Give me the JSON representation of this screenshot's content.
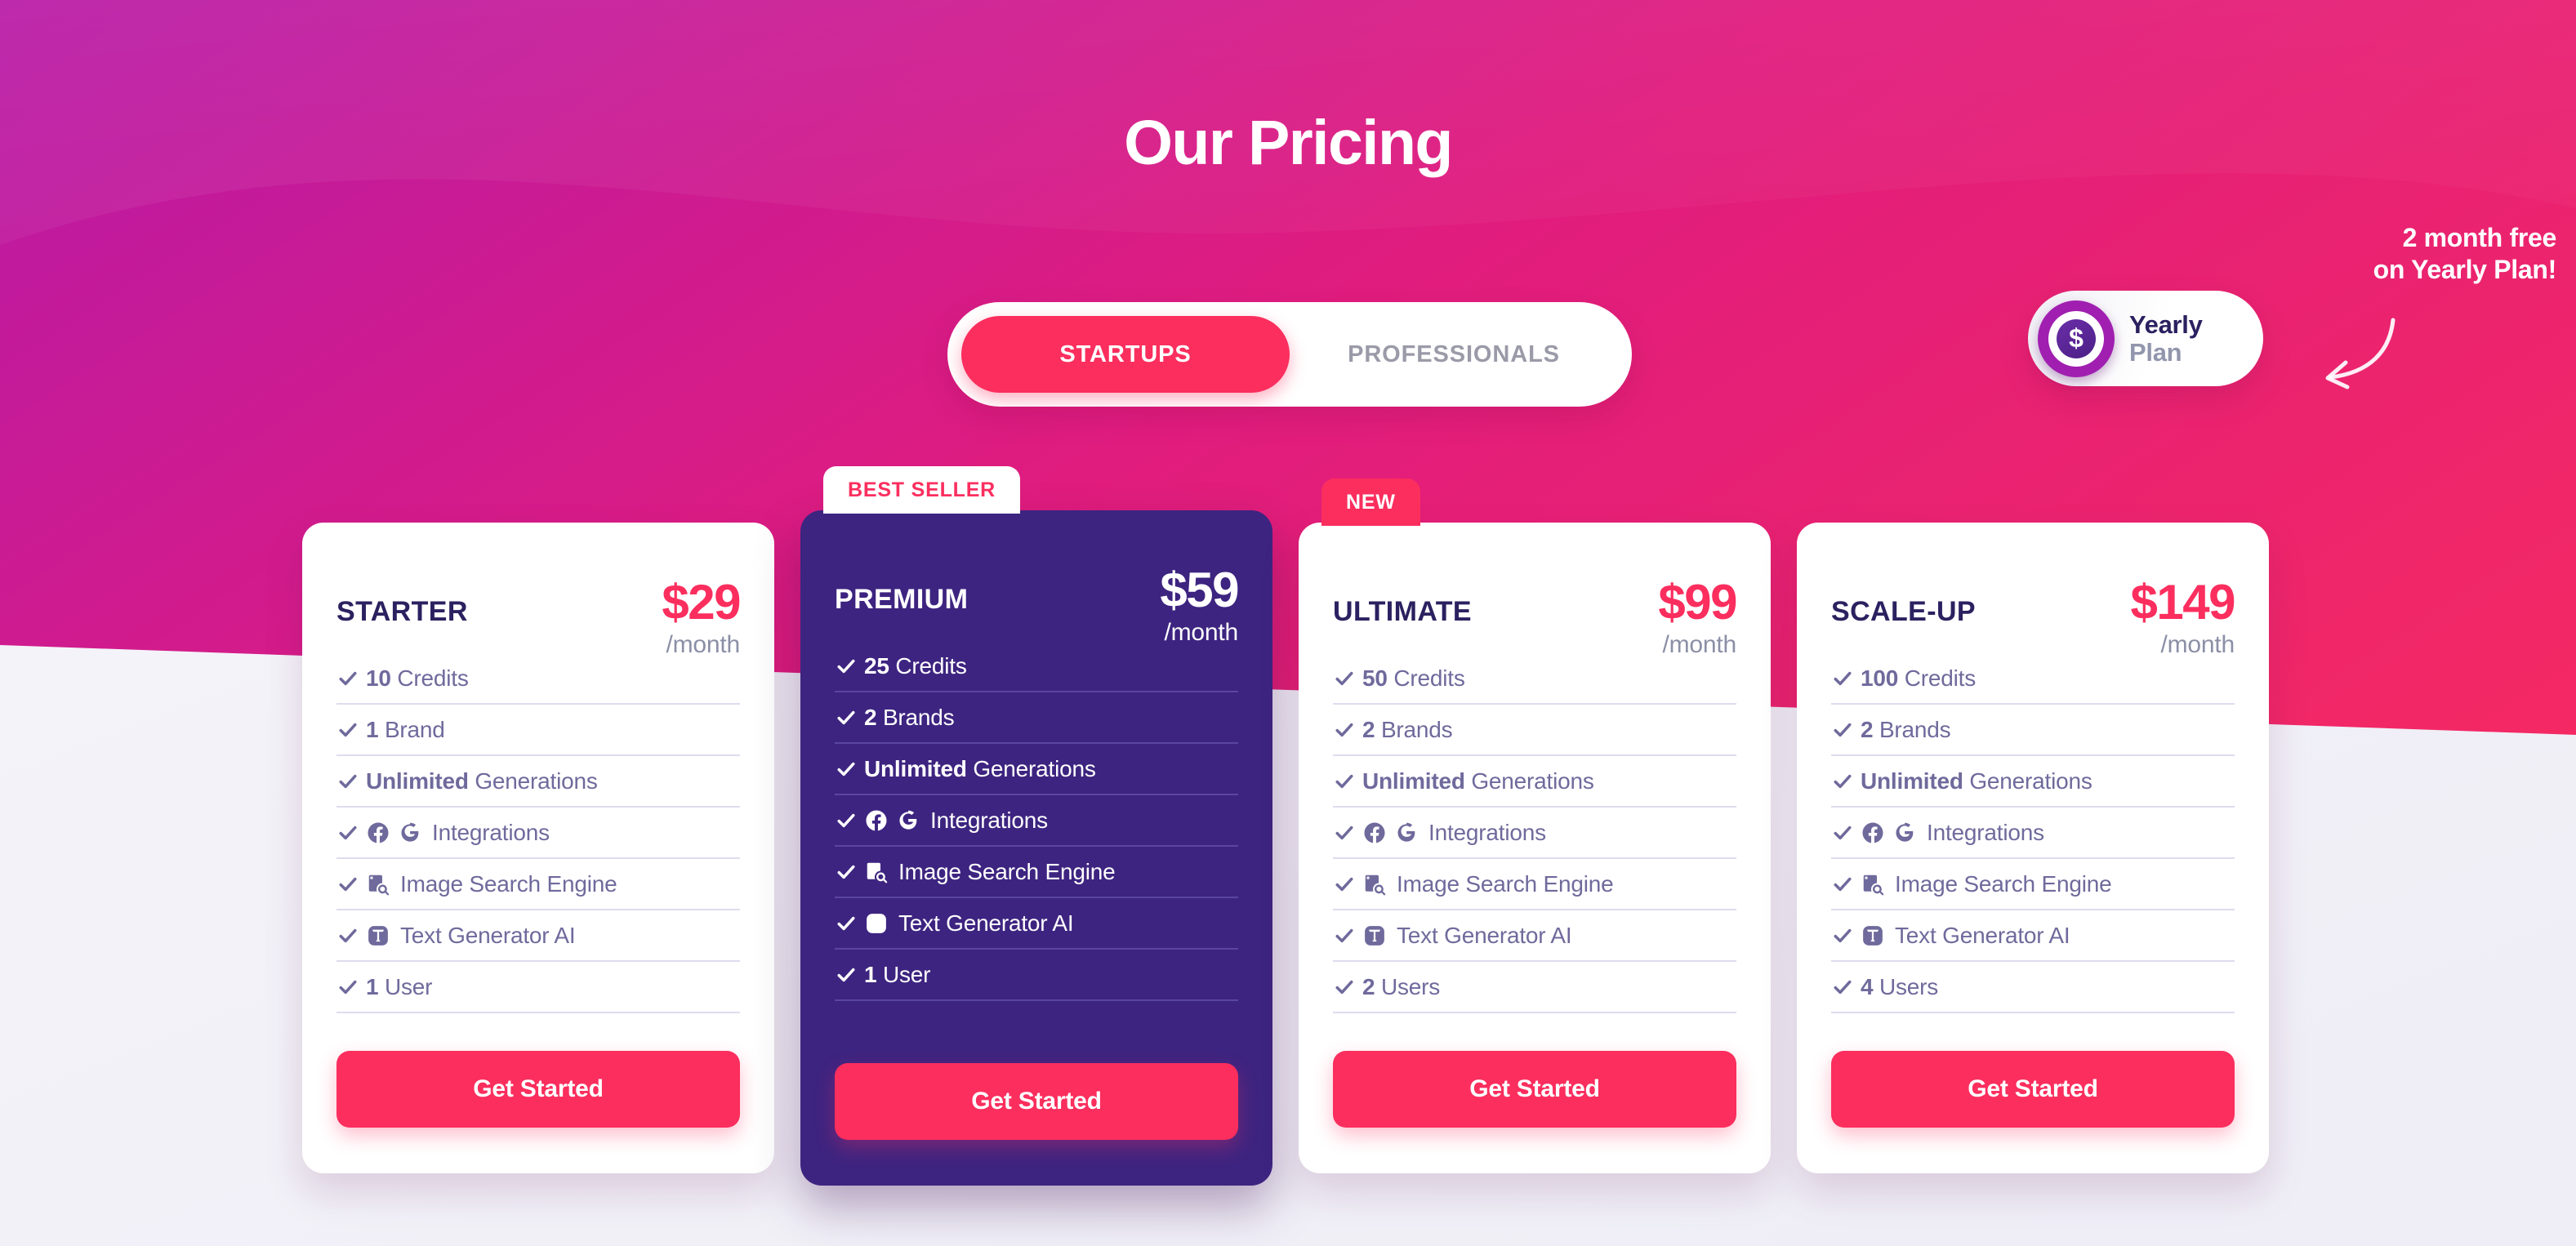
{
  "header": {
    "title": "Our Pricing"
  },
  "audience_toggle": {
    "options": [
      {
        "label": "STARTUPS",
        "active": true
      },
      {
        "label": "PROFESSIONALS",
        "active": false
      }
    ]
  },
  "billing_pill": {
    "icon": "dollar-coin-icon",
    "line1": "Yearly",
    "line2": "Plan"
  },
  "promo": {
    "line1": "2 month free",
    "line2": "on Yearly Plan!",
    "arrow_icon": "curved-arrow-left-icon"
  },
  "colors": {
    "accent_pink": "#fb2e5e",
    "dark_purple": "#3d2480",
    "navy_text": "#2b2160",
    "muted_purple_text": "#6f6a9c",
    "divider": "#dedcee",
    "bg_magenta": "#c2199a",
    "bg_pink": "#f62368",
    "page_light": "#f2f1f7"
  },
  "cta_label": "Get Started",
  "plans": [
    {
      "id": "starter",
      "name": "STARTER",
      "price": "$29",
      "period": "/month",
      "badge": null,
      "badge_style": null,
      "highlighted": false,
      "features": [
        {
          "strong": "10",
          "rest": " Credits",
          "icons": []
        },
        {
          "strong": "1",
          "rest": " Brand",
          "icons": []
        },
        {
          "strong": "Unlimited",
          "rest": " Generations",
          "icons": []
        },
        {
          "strong": "",
          "rest": "Integrations",
          "icons": [
            "facebook-icon",
            "google-icon"
          ]
        },
        {
          "strong": "",
          "rest": "Image Search Engine",
          "icons": [
            "image-search-icon"
          ]
        },
        {
          "strong": "",
          "rest": "Text Generator AI",
          "icons": [
            "text-generator-icon"
          ]
        },
        {
          "strong": "1",
          "rest": " User",
          "icons": []
        }
      ]
    },
    {
      "id": "premium",
      "name": "PREMIUM",
      "price": "$59",
      "period": "/month",
      "badge": "BEST SELLER",
      "badge_style": "best",
      "highlighted": true,
      "features": [
        {
          "strong": "25",
          "rest": " Credits",
          "icons": []
        },
        {
          "strong": "2",
          "rest": " Brands",
          "icons": []
        },
        {
          "strong": "Unlimited",
          "rest": " Generations",
          "icons": []
        },
        {
          "strong": "",
          "rest": "Integrations",
          "icons": [
            "facebook-icon",
            "google-icon"
          ]
        },
        {
          "strong": "",
          "rest": "Image Search Engine",
          "icons": [
            "image-search-icon"
          ]
        },
        {
          "strong": "",
          "rest": "Text Generator AI",
          "icons": [
            "text-generator-icon"
          ]
        },
        {
          "strong": "1",
          "rest": " User",
          "icons": []
        }
      ]
    },
    {
      "id": "ultimate",
      "name": "ULTIMATE",
      "price": "$99",
      "period": "/month",
      "badge": "NEW",
      "badge_style": "new",
      "highlighted": false,
      "features": [
        {
          "strong": "50",
          "rest": " Credits",
          "icons": []
        },
        {
          "strong": "2",
          "rest": " Brands",
          "icons": []
        },
        {
          "strong": "Unlimited",
          "rest": " Generations",
          "icons": []
        },
        {
          "strong": "",
          "rest": "Integrations",
          "icons": [
            "facebook-icon",
            "google-icon"
          ]
        },
        {
          "strong": "",
          "rest": "Image Search Engine",
          "icons": [
            "image-search-icon"
          ]
        },
        {
          "strong": "",
          "rest": "Text Generator AI",
          "icons": [
            "text-generator-icon"
          ]
        },
        {
          "strong": "2",
          "rest": " Users",
          "icons": []
        }
      ]
    },
    {
      "id": "scaleup",
      "name": "SCALE-UP",
      "price": "$149",
      "period": "/month",
      "badge": null,
      "badge_style": null,
      "highlighted": false,
      "features": [
        {
          "strong": "100",
          "rest": " Credits",
          "icons": []
        },
        {
          "strong": "2",
          "rest": " Brands",
          "icons": []
        },
        {
          "strong": "Unlimited",
          "rest": " Generations",
          "icons": []
        },
        {
          "strong": "",
          "rest": "Integrations",
          "icons": [
            "facebook-icon",
            "google-icon"
          ]
        },
        {
          "strong": "",
          "rest": "Image Search Engine",
          "icons": [
            "image-search-icon"
          ]
        },
        {
          "strong": "",
          "rest": "Text Generator AI",
          "icons": [
            "text-generator-icon"
          ]
        },
        {
          "strong": "4",
          "rest": " Users",
          "icons": []
        }
      ]
    }
  ]
}
